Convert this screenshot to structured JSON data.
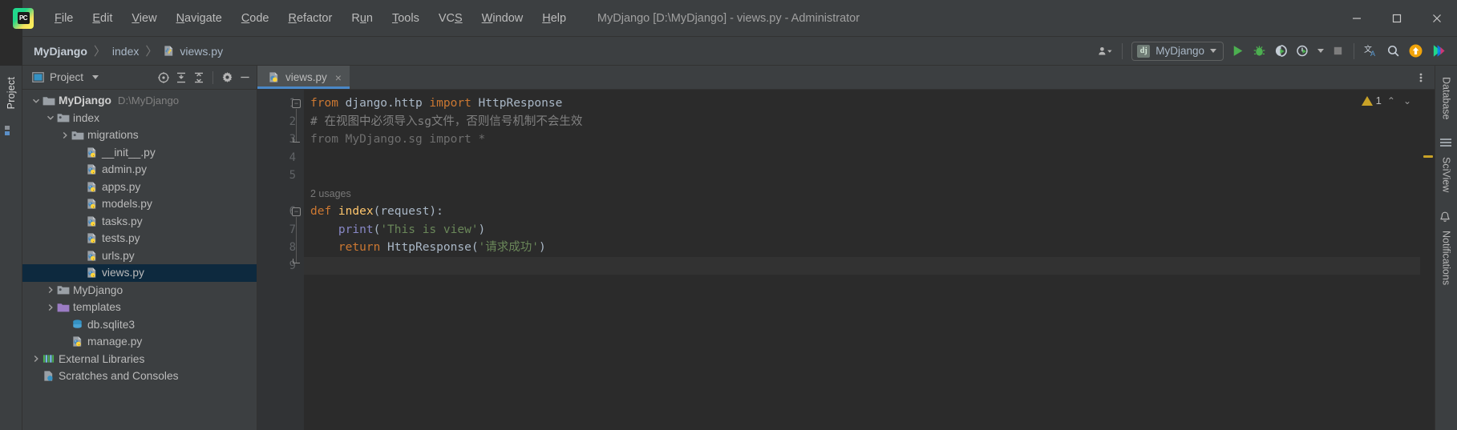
{
  "window": {
    "title": "MyDjango [D:\\MyDjango] - views.py - Administrator",
    "logo_text": "PC",
    "minimize_label": "Minimize",
    "maximize_label": "Maximize",
    "close_label": "Close"
  },
  "menu": [
    {
      "label": "File",
      "mnemonic": "F"
    },
    {
      "label": "Edit",
      "mnemonic": "E"
    },
    {
      "label": "View",
      "mnemonic": "V"
    },
    {
      "label": "Navigate",
      "mnemonic": "N"
    },
    {
      "label": "Code",
      "mnemonic": "C"
    },
    {
      "label": "Refactor",
      "mnemonic": "R"
    },
    {
      "label": "Run",
      "mnemonic": "u"
    },
    {
      "label": "Tools",
      "mnemonic": "T"
    },
    {
      "label": "VCS",
      "mnemonic": "S"
    },
    {
      "label": "Window",
      "mnemonic": "W"
    },
    {
      "label": "Help",
      "mnemonic": "H"
    }
  ],
  "breadcrumb": {
    "items": [
      "MyDjango",
      "index",
      "views.py"
    ],
    "separator": "〉"
  },
  "toolbar": {
    "run_config_label": "MyDjango",
    "run_config_icon_text": "dj",
    "buttons": [
      "user-menu",
      "run",
      "debug",
      "coverage",
      "profile",
      "stop",
      "translate",
      "search-everywhere",
      "update-project",
      "ide-features"
    ]
  },
  "left_strip": {
    "tabs": [
      "Project"
    ],
    "structure_icon": "structure-icon"
  },
  "project_panel": {
    "title": "Project",
    "header_buttons": [
      "select-opened-file",
      "expand-all",
      "collapse-all",
      "settings",
      "hide"
    ],
    "tree": [
      {
        "indent": 0,
        "twist": "open",
        "icon": "folder-module",
        "label": "MyDjango",
        "bold": true,
        "path": "D:\\MyDjango",
        "selected": false
      },
      {
        "indent": 1,
        "twist": "open",
        "icon": "folder-source",
        "label": "index",
        "bold": false,
        "path": "",
        "selected": false
      },
      {
        "indent": 2,
        "twist": "closed",
        "icon": "folder-source",
        "label": "migrations",
        "bold": false,
        "path": "",
        "selected": false
      },
      {
        "indent": 3,
        "twist": "none",
        "icon": "python-file",
        "label": "__init__.py",
        "bold": false,
        "path": "",
        "selected": false
      },
      {
        "indent": 3,
        "twist": "none",
        "icon": "python-file",
        "label": "admin.py",
        "bold": false,
        "path": "",
        "selected": false
      },
      {
        "indent": 3,
        "twist": "none",
        "icon": "python-file",
        "label": "apps.py",
        "bold": false,
        "path": "",
        "selected": false
      },
      {
        "indent": 3,
        "twist": "none",
        "icon": "python-file",
        "label": "models.py",
        "bold": false,
        "path": "",
        "selected": false
      },
      {
        "indent": 3,
        "twist": "none",
        "icon": "python-file",
        "label": "tasks.py",
        "bold": false,
        "path": "",
        "selected": false
      },
      {
        "indent": 3,
        "twist": "none",
        "icon": "python-file",
        "label": "tests.py",
        "bold": false,
        "path": "",
        "selected": false
      },
      {
        "indent": 3,
        "twist": "none",
        "icon": "python-file",
        "label": "urls.py",
        "bold": false,
        "path": "",
        "selected": false
      },
      {
        "indent": 3,
        "twist": "none",
        "icon": "python-file",
        "label": "views.py",
        "bold": false,
        "path": "",
        "selected": true
      },
      {
        "indent": 1,
        "twist": "closed",
        "icon": "folder-source",
        "label": "MyDjango",
        "bold": false,
        "path": "",
        "selected": false
      },
      {
        "indent": 1,
        "twist": "closed",
        "icon": "folder-purple",
        "label": "templates",
        "bold": false,
        "path": "",
        "selected": false
      },
      {
        "indent": 2,
        "twist": "none",
        "icon": "db-file",
        "label": "db.sqlite3",
        "bold": false,
        "path": "",
        "selected": false
      },
      {
        "indent": 2,
        "twist": "none",
        "icon": "python-file",
        "label": "manage.py",
        "bold": false,
        "path": "",
        "selected": false
      },
      {
        "indent": 0,
        "twist": "closed",
        "icon": "libraries",
        "label": "External Libraries",
        "bold": false,
        "path": "",
        "selected": false
      },
      {
        "indent": 0,
        "twist": "none",
        "icon": "scratches",
        "label": "Scratches and Consoles",
        "bold": false,
        "path": "",
        "selected": false
      }
    ]
  },
  "editor": {
    "tabs": [
      {
        "label": "views.py",
        "icon": "python-file",
        "active": true,
        "close": "×"
      }
    ],
    "options_icon": "more-options-icon",
    "warning_count": "1",
    "prev_label": "⌃",
    "next_label": "⌄",
    "inlay_hint": "2 usages",
    "lines": [
      {
        "num": "1",
        "current": false
      },
      {
        "num": "2",
        "current": false
      },
      {
        "num": "3",
        "current": false
      },
      {
        "num": "4",
        "current": false
      },
      {
        "num": "5",
        "current": false
      },
      {
        "num": "6",
        "current": false
      },
      {
        "num": "7",
        "current": false
      },
      {
        "num": "8",
        "current": false
      },
      {
        "num": "9",
        "current": true
      }
    ],
    "code": {
      "l1": {
        "kw1": "from",
        "mod": " django.http ",
        "kw2": "import",
        "rest": " HttpResponse"
      },
      "l2": {
        "text": "# 在视图中必须导入sg文件，否则信号机制不会生效"
      },
      "l3": {
        "text": "from MyDjango.sg import *"
      },
      "l6": {
        "kw": "def",
        "name": " index",
        "args": "(request):"
      },
      "l7": {
        "fn": "print",
        "p1": "(",
        "str": "'This is view'",
        "p2": ")"
      },
      "l8": {
        "kw": "return",
        "fn": " HttpResponse",
        "p1": "(",
        "str": "'请求成功'",
        "p2": ")"
      }
    }
  },
  "right_strip": {
    "tabs": [
      "Database",
      "SciView",
      "Notifications"
    ]
  },
  "colors": {
    "accent": "#4a88c7",
    "selection": "#0d293e",
    "keyword": "#cc7832",
    "string": "#6a8759",
    "function": "#ffc66d",
    "comment": "#808080",
    "warning": "#c9a227",
    "editor_bg": "#2b2b2b",
    "panel_bg": "#3c3f41"
  }
}
